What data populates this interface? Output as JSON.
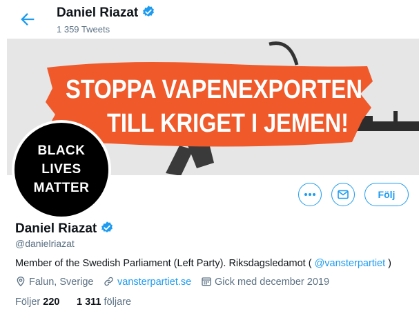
{
  "header": {
    "name": "Daniel Riazat",
    "tweet_count": "1 359 Tweets"
  },
  "banner": {
    "line1": "STOPPA VAPENEXPORTEN",
    "line2": "TILL KRIGET I JEMEN!"
  },
  "avatar": {
    "lines": [
      "BLACK",
      "LIVES",
      "MATTER"
    ]
  },
  "actions": {
    "more_icon": "more-icon",
    "message_icon": "envelope-icon",
    "follow_label": "Följ"
  },
  "profile": {
    "name": "Daniel Riazat",
    "handle": "@danielriazat",
    "bio_text": "Member of the Swedish Parliament (Left Party). Riksdagsledamot ( ",
    "bio_mention": "@vansterpartiet",
    "bio_end": " )",
    "location": "Falun, Sverige",
    "website": "vansterpartiet.se",
    "joined": "Gick med december 2019",
    "following_label": "Följer",
    "following_count": "220",
    "followers_count": "1 311",
    "followers_label": "följare"
  },
  "colors": {
    "accent": "#1d9bf0",
    "banner_red": "#f0592a",
    "secondary_text": "#5b7083"
  }
}
